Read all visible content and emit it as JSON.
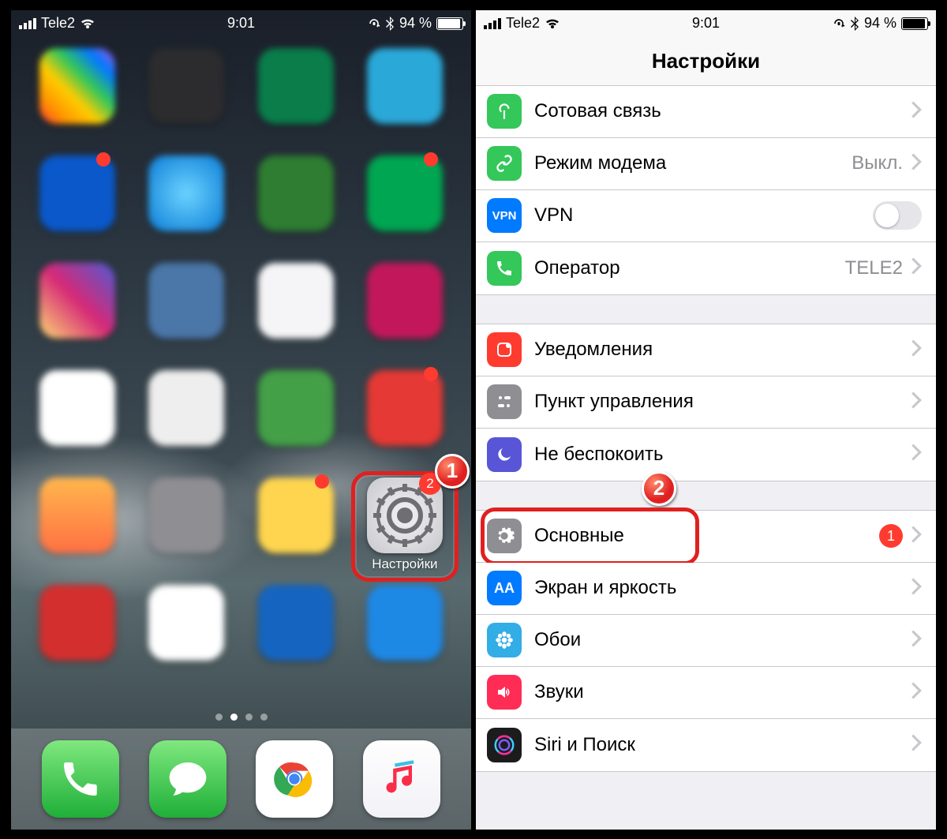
{
  "status": {
    "carrier": "Tele2",
    "time": "9:01",
    "battery_pct": "94 %"
  },
  "home": {
    "settings_app_label": "Настройки",
    "settings_badge": "2",
    "page_count": 4,
    "active_page": 1
  },
  "callouts": {
    "one": "1",
    "two": "2"
  },
  "settings": {
    "title": "Настройки",
    "rows": {
      "cellular": {
        "label": "Сотовая связь"
      },
      "hotspot": {
        "label": "Режим модема",
        "value": "Выкл."
      },
      "vpn": {
        "label": "VPN"
      },
      "carrier": {
        "label": "Оператор",
        "value": "TELE2"
      },
      "notifications": {
        "label": "Уведомления"
      },
      "controlcenter": {
        "label": "Пункт управления"
      },
      "dnd": {
        "label": "Не беспокоить"
      },
      "general": {
        "label": "Основные",
        "badge": "1"
      },
      "display": {
        "label": "Экран и яркость"
      },
      "wallpaper": {
        "label": "Обои"
      },
      "sounds": {
        "label": "Звуки"
      },
      "siri": {
        "label": "Siri и Поиск"
      }
    }
  }
}
